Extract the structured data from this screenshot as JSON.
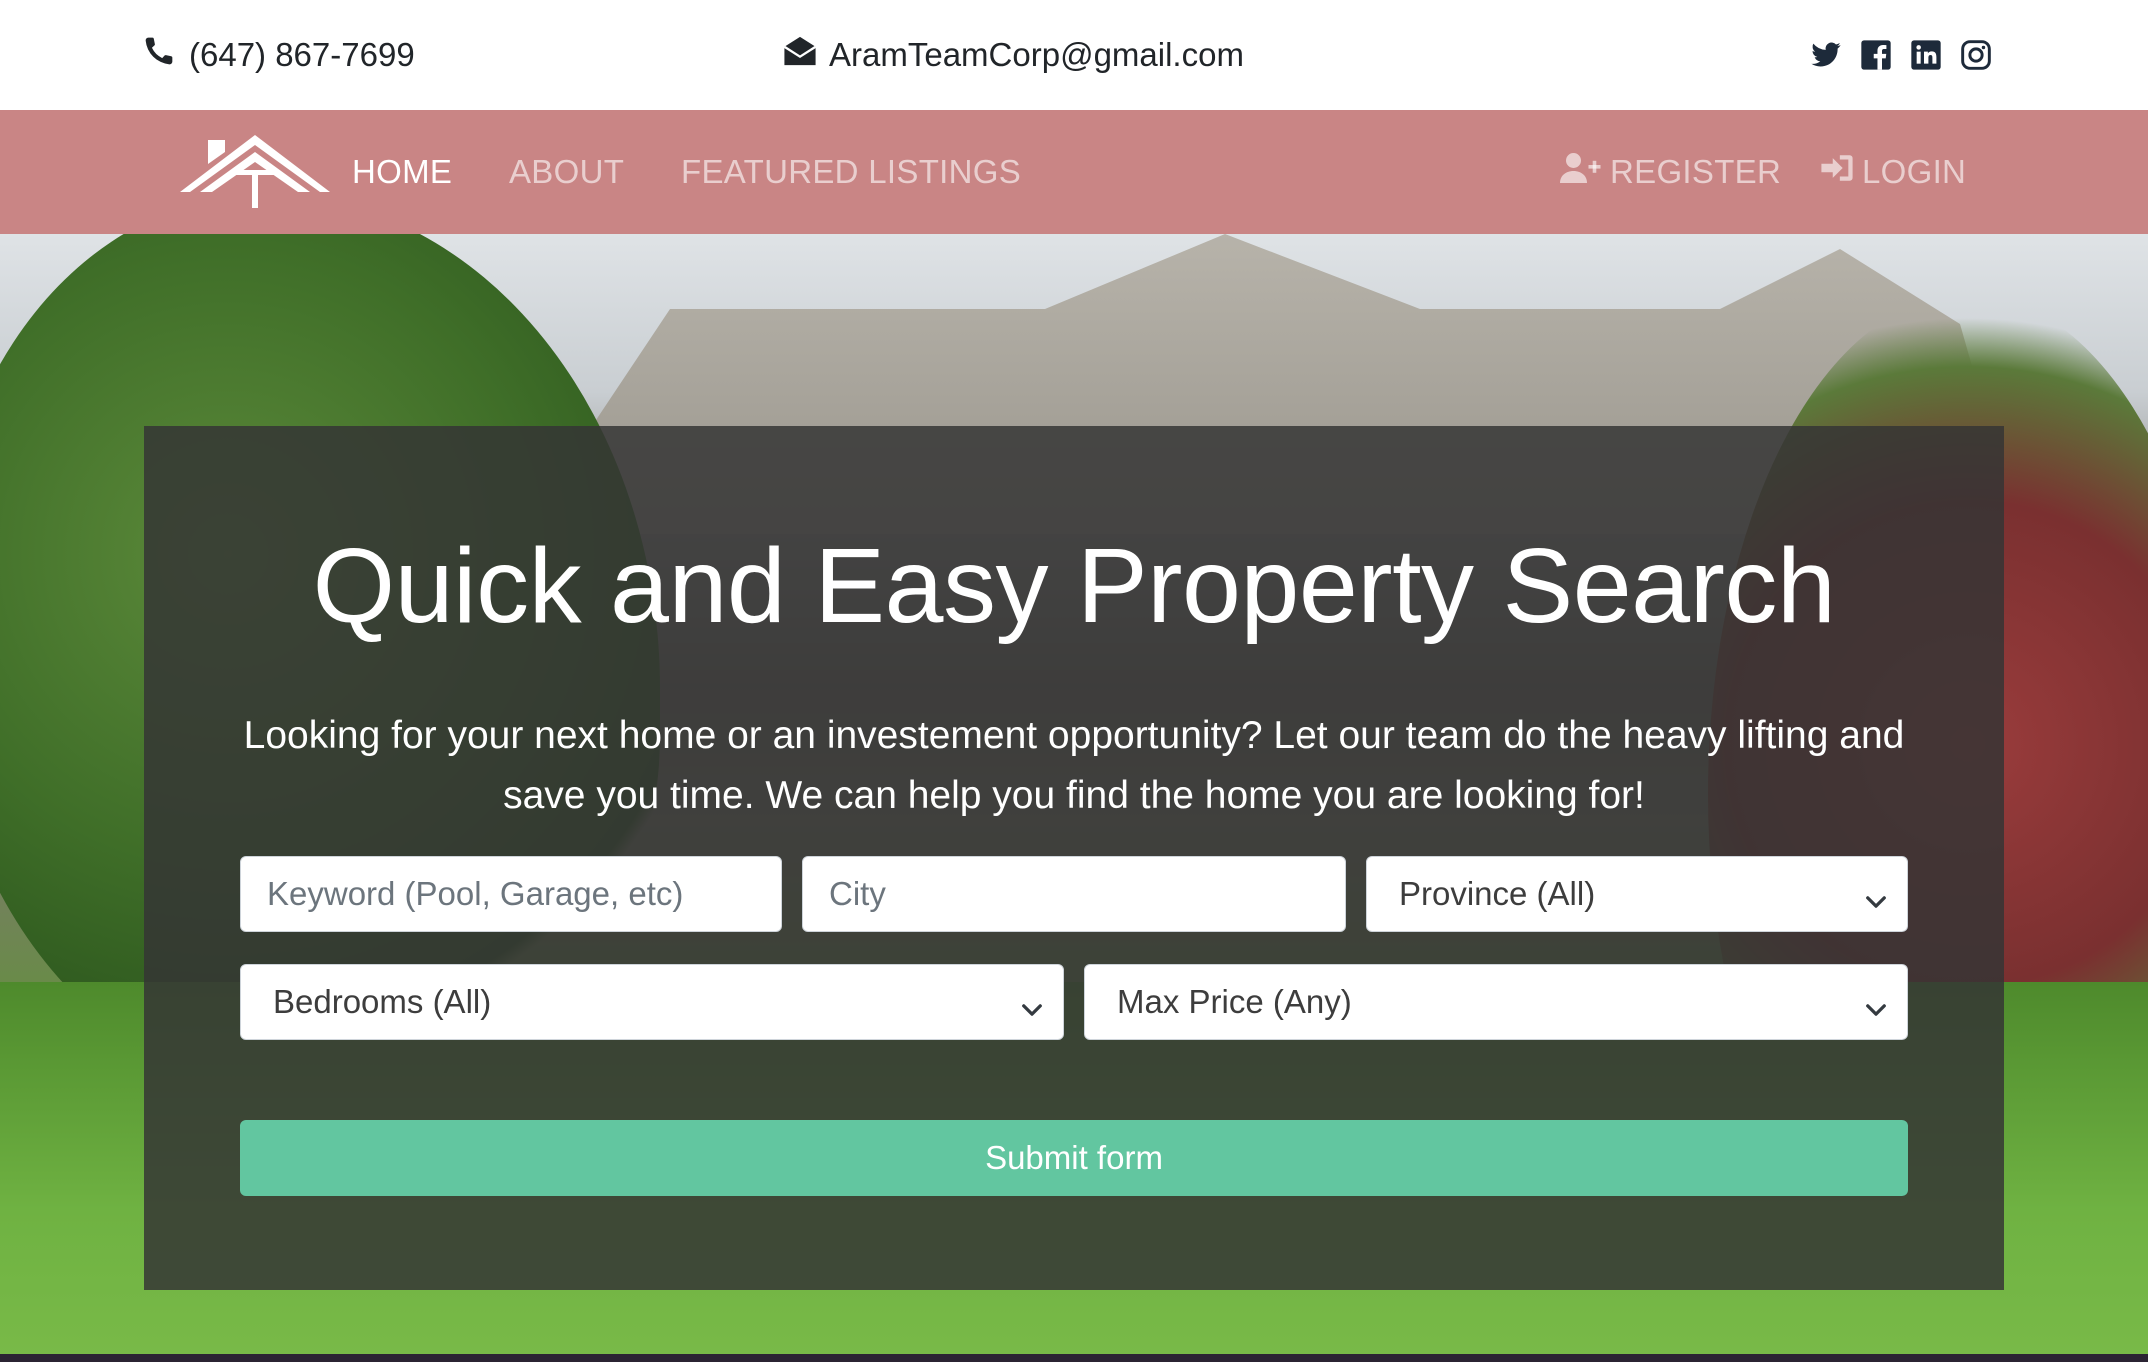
{
  "contact": {
    "phone": "(647) 867-7699",
    "email": "AramTeamCorp@gmail.com",
    "phone_icon": "phone-icon",
    "email_icon": "envelope-open-icon"
  },
  "social": [
    {
      "name": "twitter-icon"
    },
    {
      "name": "facebook-icon"
    },
    {
      "name": "linkedin-icon"
    },
    {
      "name": "instagram-icon"
    }
  ],
  "nav": {
    "logo": "roof-logo-icon",
    "items": [
      {
        "label": "HOME",
        "active": true
      },
      {
        "label": "ABOUT",
        "active": false
      },
      {
        "label": "FEATURED LISTINGS",
        "active": false
      }
    ],
    "register": {
      "label": "REGISTER",
      "icon": "user-plus-icon"
    },
    "login": {
      "label": "LOGIN",
      "icon": "sign-in-icon"
    }
  },
  "hero": {
    "title": "Quick and Easy Property Search",
    "subtitle": "Looking for your next home or an investement opportunity? Let our team do the heavy lifting and save you time. We can help you find the home you are looking for!"
  },
  "search": {
    "keyword_placeholder": "Keyword (Pool, Garage, etc)",
    "city_placeholder": "City",
    "province": "Province (All)",
    "bedrooms": "Bedrooms (All)",
    "max_price": "Max Price (Any)",
    "submit_label": "Submit form"
  },
  "colors": {
    "navbar": "#c98585",
    "submit": "#62c6a0",
    "panel": "#343434"
  }
}
